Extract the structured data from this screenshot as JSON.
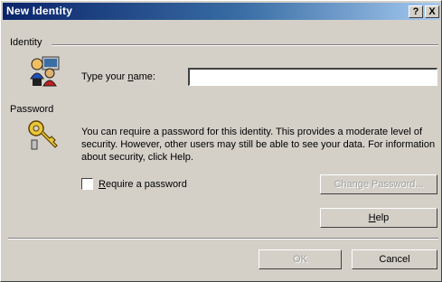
{
  "window": {
    "title": "New Identity",
    "help_button": "?",
    "close_button": "X"
  },
  "identity": {
    "group_label": "Identity",
    "icon": "identity-people-icon",
    "name_label_pre": "Type your ",
    "name_label_access": "n",
    "name_label_post": "ame:",
    "name_value": ""
  },
  "password": {
    "group_label": "Password",
    "icon": "password-key-icon",
    "description": "You can require a password for this identity.  This provides a moderate level of security. However, other users may still be able to see your data. For information about security, click Help.",
    "require_access": "R",
    "require_label": "equire a password",
    "require_checked": false,
    "change_button": "Change Password...",
    "help_access": "H",
    "help_label": "elp"
  },
  "footer": {
    "ok": "OK",
    "cancel": "Cancel"
  }
}
